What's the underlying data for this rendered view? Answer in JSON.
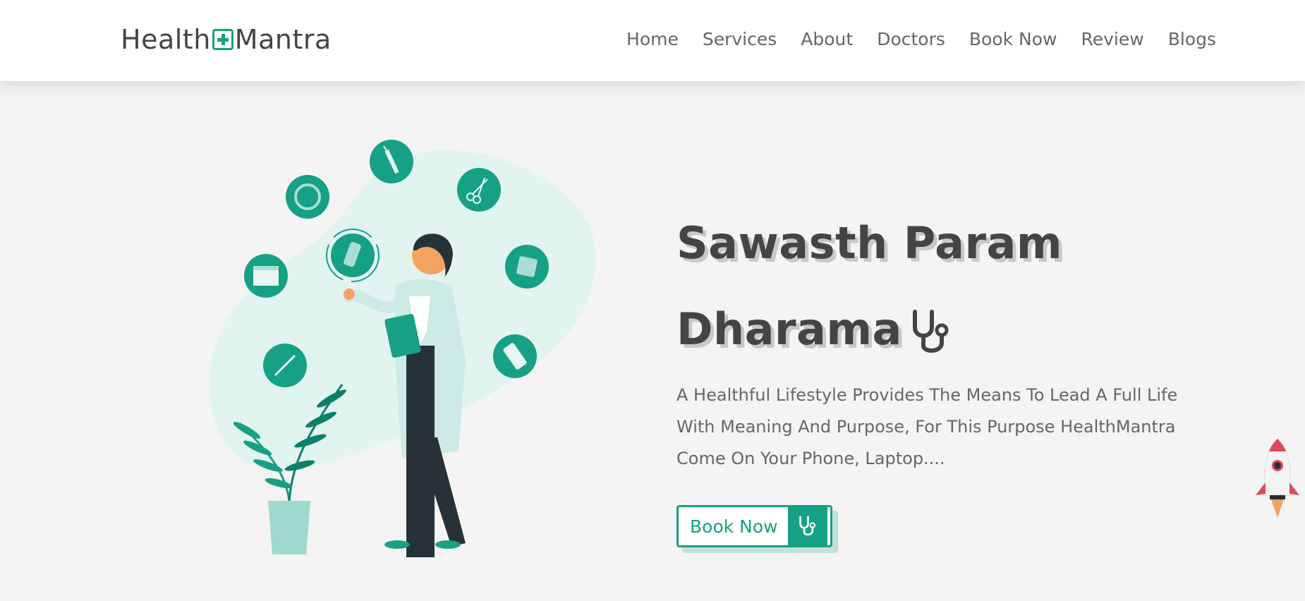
{
  "header": {
    "logo_left": "Health",
    "logo_right": "Mantra",
    "nav": [
      "Home",
      "Services",
      "About",
      "Doctors",
      "Book Now",
      "Review",
      "Blogs"
    ]
  },
  "hero": {
    "title_line1": "Sawasth Param",
    "title_line2": "Dharama",
    "description": "A Healthful Lifestyle Provides The Means To Lead A Full Life With Meaning And Purpose, For This Purpose HealthMantra Come On Your Phone, Laptop....",
    "button_label": "Book Now"
  },
  "icons": {
    "logo": "medical-plus-icon",
    "title": "stethoscope-icon",
    "button": "stethoscope-icon",
    "scroll_top": "rocket-icon"
  },
  "colors": {
    "accent": "#16a085",
    "text": "#444444",
    "background": "#f4f4f4"
  }
}
